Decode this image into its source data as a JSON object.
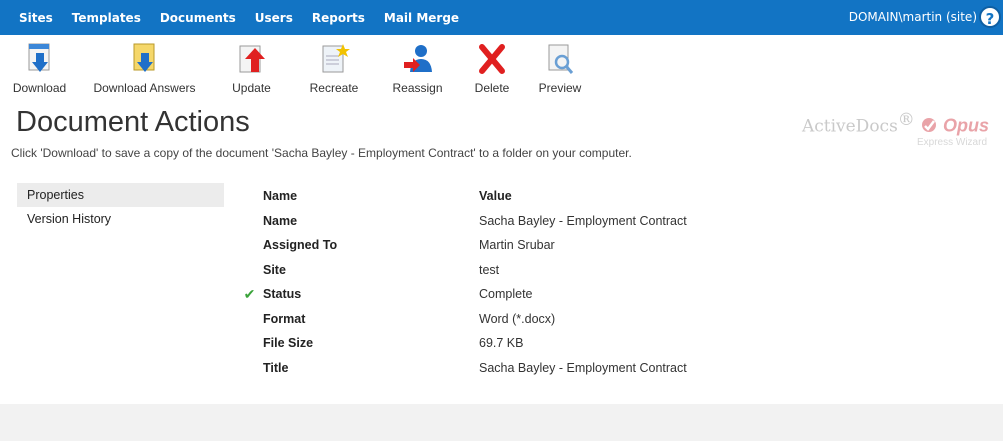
{
  "nav": {
    "items": [
      "Sites",
      "Templates",
      "Documents",
      "Users",
      "Reports",
      "Mail Merge"
    ],
    "user": "DOMAIN\\martin (site)",
    "help": "?"
  },
  "toolbar": {
    "download": "Download",
    "download_answers": "Download Answers",
    "update": "Update",
    "recreate": "Recreate",
    "reassign": "Reassign",
    "delete": "Delete",
    "preview": "Preview"
  },
  "page": {
    "title": "Document Actions",
    "subtitle": "Click 'Download' to save a copy of the document 'Sacha Bayley - Employment Contract' to a folder on your computer."
  },
  "logo": {
    "brand": "ActiveDocs",
    "tm": "®",
    "opus": "Opus",
    "sub": "Express Wizard"
  },
  "side": {
    "properties": "Properties",
    "version_history": "Version History"
  },
  "table": {
    "header_name": "Name",
    "header_value": "Value",
    "rows": [
      {
        "name": "Name",
        "value": "Sacha Bayley - Employment Contract"
      },
      {
        "name": "Assigned To",
        "value": "Martin Srubar"
      },
      {
        "name": "Site",
        "value": "test"
      },
      {
        "name": "Status",
        "value": "Complete",
        "check": "✔"
      },
      {
        "name": "Format",
        "value": "Word (*.docx)"
      },
      {
        "name": "File Size",
        "value": "69.7 KB"
      },
      {
        "name": "Title",
        "value": "Sacha Bayley - Employment Contract"
      }
    ]
  },
  "colors": {
    "nav_bg": "#1274c4",
    "accent_red": "#e02020",
    "accent_blue": "#1f77d0"
  }
}
